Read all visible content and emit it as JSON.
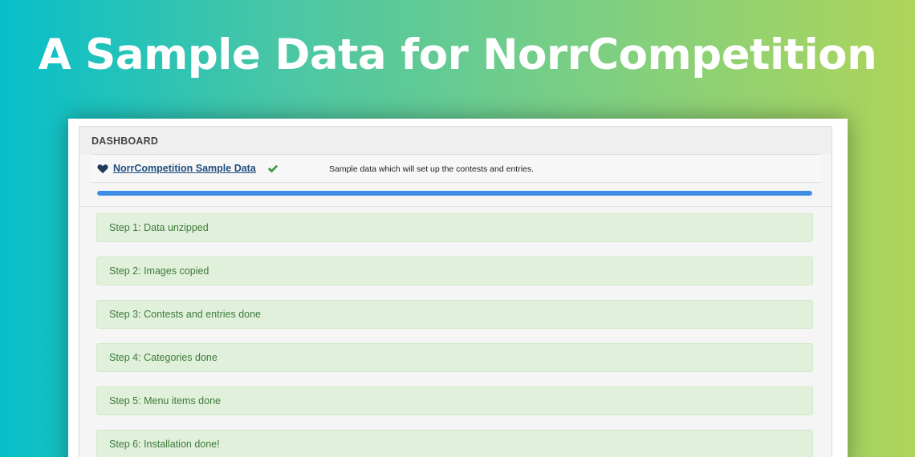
{
  "banner": {
    "title": "A Sample Data for NorrCompetition"
  },
  "dashboard": {
    "header": "DASHBOARD",
    "package": {
      "name": "NorrCompetition Sample Data",
      "description": "Sample data which will set up the contests and entries.",
      "icon": "heart-icon",
      "status_icon": "check-icon"
    },
    "progress": {
      "percent": 100,
      "color": "#3d8ce6"
    },
    "steps": [
      "Step 1: Data unzipped",
      "Step 2: Images copied",
      "Step 3: Contests and entries done",
      "Step 4: Categories done",
      "Step 5: Menu items done",
      "Step 6: Installation done!"
    ]
  },
  "colors": {
    "gradient_start": "#06bfca",
    "gradient_end": "#aed45a",
    "link": "#1f4f7e",
    "success_text": "#3d7a3a",
    "success_bg": "#e0f0da",
    "check": "#3a9a3a"
  }
}
